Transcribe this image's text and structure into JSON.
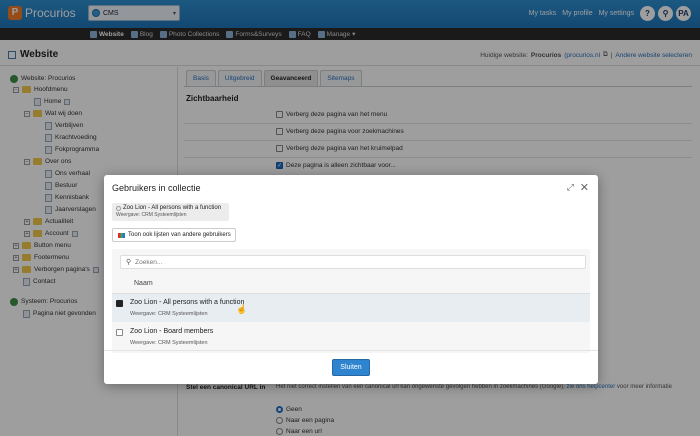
{
  "app": {
    "logo_text": "Procurios",
    "site_selector": "CMS",
    "top_links": [
      "My tasks",
      "My profile",
      "My settings"
    ],
    "help_label": "?",
    "search_label": "⚲",
    "user_initials": "PA"
  },
  "nav": {
    "items": [
      {
        "label": "Website",
        "active": true
      },
      {
        "label": "Blog",
        "active": false
      },
      {
        "label": "Photo Collections",
        "active": false
      },
      {
        "label": "Forms&Surveys",
        "active": false
      },
      {
        "label": "FAQ",
        "active": false
      },
      {
        "label": "Manage",
        "active": false
      }
    ],
    "manage_caret": "▾"
  },
  "page": {
    "title": "Website",
    "current_site_label": "Huidige website:",
    "current_site_name": "Procurios",
    "current_site_url": "(procurios.nl",
    "select_other": "Andere website selecteren"
  },
  "tree": {
    "items": [
      {
        "label": "Website: Procurios",
        "type": "globe"
      },
      {
        "label": "Hoofdmenu",
        "type": "folder"
      },
      {
        "label": "Home",
        "type": "page"
      },
      {
        "label": "Wat wij doen",
        "type": "folder"
      },
      {
        "label": "Verblijven",
        "type": "page"
      },
      {
        "label": "Krachtvoeding",
        "type": "page"
      },
      {
        "label": "Fokprogramma",
        "type": "page"
      },
      {
        "label": "Over ons",
        "type": "folder"
      },
      {
        "label": "Ons verhaal",
        "type": "page"
      },
      {
        "label": "Bestuur",
        "type": "page"
      },
      {
        "label": "Kennisbank",
        "type": "page"
      },
      {
        "label": "Jaarverslagen",
        "type": "page"
      },
      {
        "label": "Actualiteit",
        "type": "folder"
      },
      {
        "label": "Account",
        "type": "folder"
      },
      {
        "label": "Button menu",
        "type": "folder"
      },
      {
        "label": "Footermenu",
        "type": "folder"
      },
      {
        "label": "Verborgen pagina's",
        "type": "folder"
      },
      {
        "label": "Contact",
        "type": "page"
      },
      {
        "label": "Systeem: Procurios",
        "type": "globe"
      },
      {
        "label": "Pagina niet gevonden",
        "type": "page"
      }
    ]
  },
  "tabs": [
    "Basis",
    "Uitgebreid",
    "Geavanceerd",
    "Sitemaps"
  ],
  "visibility": {
    "title": "Zichtbaarheid",
    "options": [
      {
        "label": "Verberg deze pagina van het menu",
        "checked": false
      },
      {
        "label": "Verberg deze pagina voor zoekmachines",
        "checked": false
      },
      {
        "label": "Verberg deze pagina van het kruimelpad",
        "checked": false
      },
      {
        "label": "Deze pagina is alleen zichtbaar voor...",
        "checked": true
      }
    ]
  },
  "canonical": {
    "label": "Stel een canonical URL in",
    "desc": "Het niet correct instellen van een canonical url kan ongewenste gevolgen hebben in zoekmachines (Google),",
    "link": "zie ons helpcenter",
    "desc_end": "voor meer informatie",
    "options": [
      {
        "label": "Geen",
        "checked": true
      },
      {
        "label": "Naar een pagina",
        "checked": false
      },
      {
        "label": "Naar een url",
        "checked": false
      }
    ]
  },
  "modal": {
    "title": "Gebruikers in collectie",
    "collection_name": "Zoo Lion - All persons with a function",
    "collection_sub": "Weergave: CRM Systeemlijsten",
    "show_other_label": "Toon ook lijsten van andere gebruikers",
    "search_placeholder": "Zoeken...",
    "column_header": "Naam",
    "rows": [
      {
        "name": "Zoo Lion - All persons with a function",
        "sub": "Weergave: CRM Systeemlijsten",
        "checked": true
      },
      {
        "name": "Zoo Lion - Board members",
        "sub": "Weergave: CRM Systeemlijsten",
        "checked": false
      }
    ],
    "close_label": "Sluiten"
  }
}
